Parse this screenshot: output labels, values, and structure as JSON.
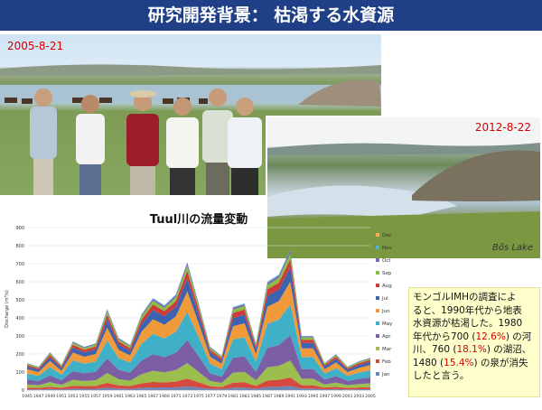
{
  "title": "研究開発背景： 枯渇する水資源",
  "photos": {
    "left_date": "2005-8-21",
    "right_date": "2012-8-22",
    "right_caption": "Bős Lake"
  },
  "note": {
    "line1": "モンゴルIMHの調査によ",
    "line2": "ると、1990年代から地表",
    "line3": "水資源が枯渇した。1980",
    "line4a": "年代から700 (",
    "pct1": "12.6%",
    "line4b": ") の河",
    "line5a": "川、760 (",
    "pct2": "18.1%",
    "line5b": ") の湖沼、",
    "line6a": "1480 (",
    "pct3": "15.4%",
    "line6b": ") の泉が消失",
    "line7": "したと言う。"
  },
  "colors": {
    "accent_red": "#d40000",
    "title_bg": "#1f3f86",
    "note_bg": "#ffffcc"
  },
  "chart_data": {
    "type": "area",
    "title": "Tuul川の流量変動",
    "ylabel": "Discharge (m³/s)",
    "xlabel": "",
    "ylim": [
      0,
      900
    ],
    "yticks": [
      0,
      100,
      200,
      300,
      400,
      500,
      600,
      700,
      800,
      900
    ],
    "legend_position": "right",
    "x": [
      1945,
      1947,
      1949,
      1951,
      1953,
      1955,
      1957,
      1959,
      1961,
      1963,
      1965,
      1967,
      1969,
      1971,
      1973,
      1975,
      1977,
      1979,
      1981,
      1983,
      1985,
      1987,
      1989,
      1991,
      1993,
      1995,
      1997,
      1999,
      2001,
      2003,
      2005
    ],
    "x_tick_labels": [
      "1945",
      "1947",
      "1949",
      "1951",
      "1953",
      "1955",
      "1957",
      "1959",
      "1961",
      "1963",
      "1965",
      "1967",
      "1969",
      "1971",
      "1973",
      "1975",
      "1977",
      "1979",
      "1981",
      "1983",
      "1985",
      "1987",
      "1989",
      "1991",
      "1993",
      "1995",
      "1997",
      "1999",
      "2001",
      "2003",
      "2005"
    ],
    "totals": [
      150,
      130,
      210,
      140,
      270,
      240,
      260,
      450,
      290,
      250,
      420,
      510,
      470,
      530,
      710,
      480,
      240,
      190,
      460,
      480,
      260,
      600,
      640,
      780,
      300,
      300,
      150,
      200,
      130,
      160,
      180
    ],
    "shares": [
      0.03,
      0.06,
      0.12,
      0.18,
      0.22,
      0.16,
      0.1,
      0.06,
      0.04,
      0.02,
      0.01,
      0.0
    ],
    "series": [
      {
        "name": "Jan",
        "color": "#6d84b8"
      },
      {
        "name": "Feb",
        "color": "#d6493f"
      },
      {
        "name": "Mar",
        "color": "#9bbe4c"
      },
      {
        "name": "Apr",
        "color": "#7b5ea4"
      },
      {
        "name": "May",
        "color": "#3fb0c8"
      },
      {
        "name": "Jun",
        "color": "#f09a3b"
      },
      {
        "name": "Jul",
        "color": "#3d63b0"
      },
      {
        "name": "Aug",
        "color": "#cf3b3b"
      },
      {
        "name": "Sep",
        "color": "#8bbf3f"
      },
      {
        "name": "Oct",
        "color": "#8068b0"
      },
      {
        "name": "Nov",
        "color": "#52b3d0"
      },
      {
        "name": "Dec",
        "color": "#f4ad5c"
      }
    ]
  }
}
